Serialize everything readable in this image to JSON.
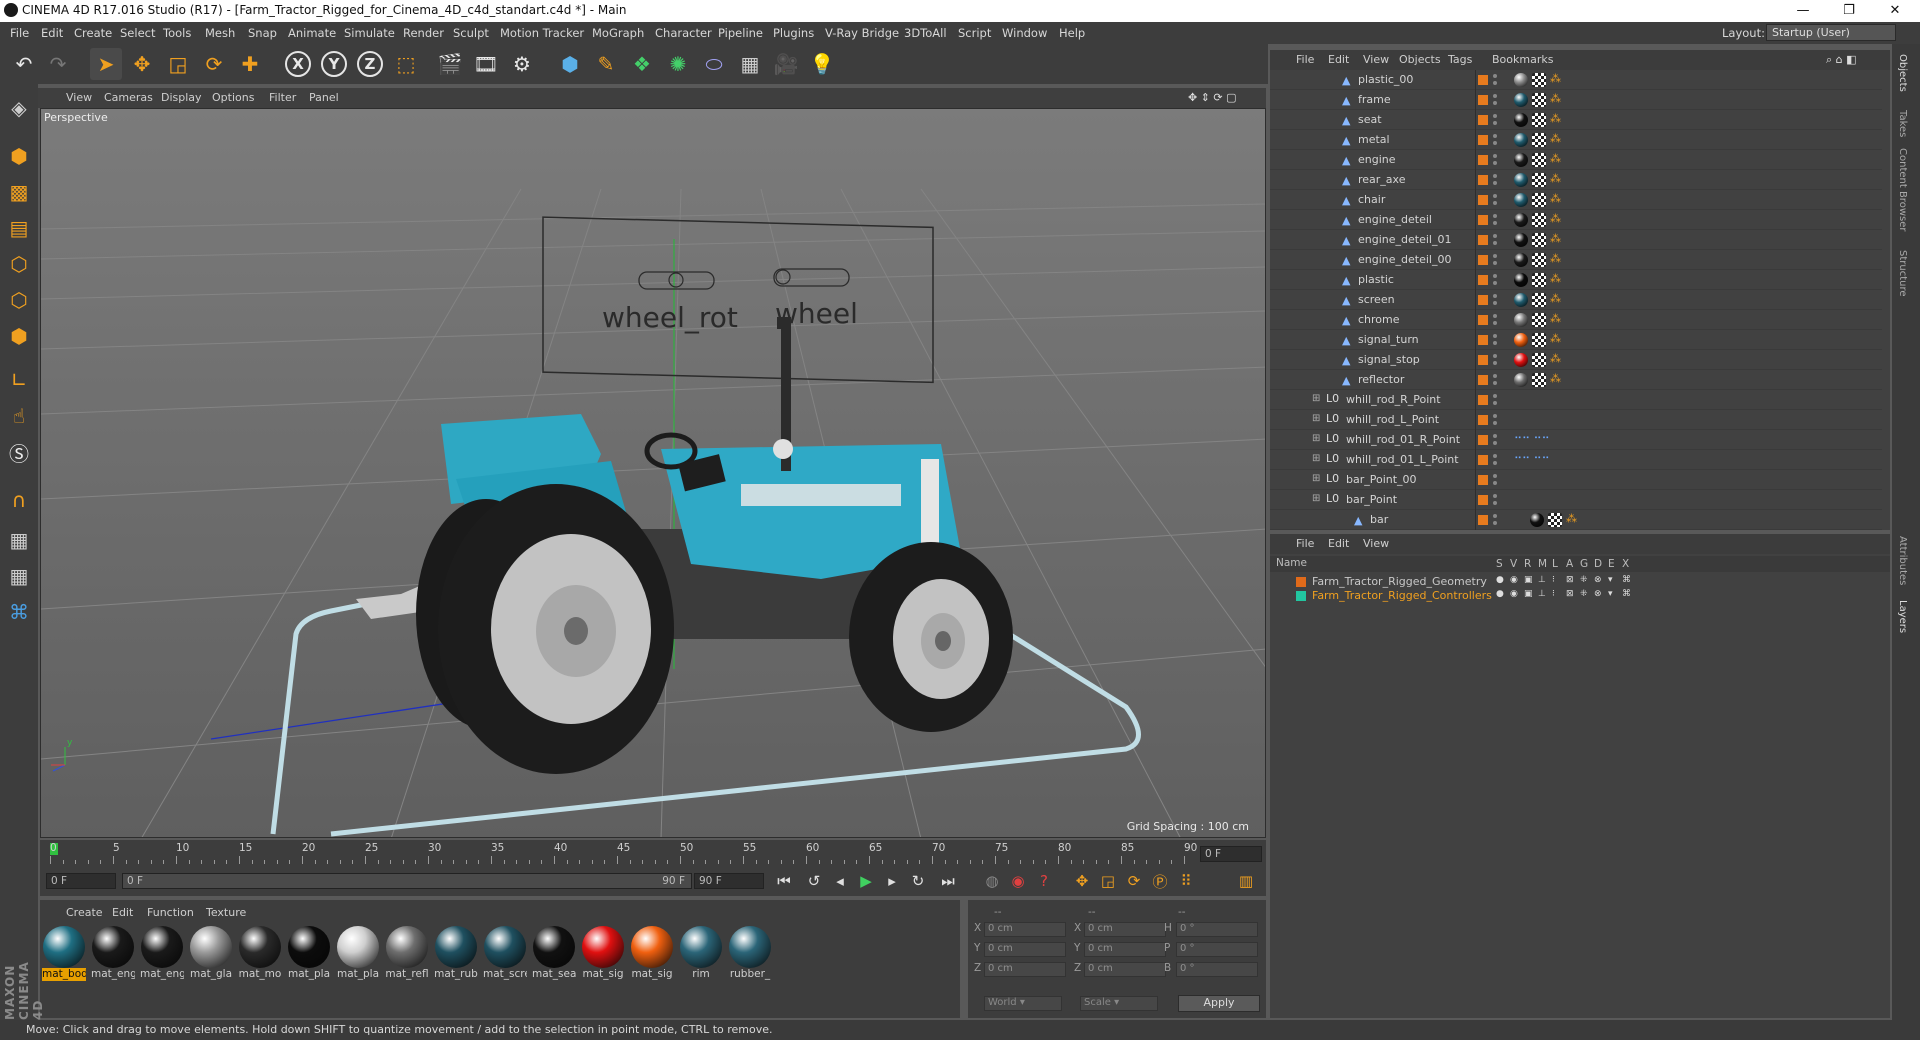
{
  "window": {
    "title": "CINEMA 4D R17.016 Studio (R17) - [Farm_Tractor_Rigged_for_Cinema_4D_c4d_standart.c4d *] - Main",
    "minimize": "—",
    "maximize": "❐",
    "close": "✕"
  },
  "menubar": {
    "items": [
      "File",
      "Edit",
      "Create",
      "Select",
      "Tools",
      "Mesh",
      "Snap",
      "Animate",
      "Simulate",
      "Render",
      "Sculpt",
      "Motion Tracker",
      "MoGraph",
      "Character",
      "Pipeline",
      "Plugins",
      "V-Ray Bridge",
      "3DToAll",
      "Script",
      "Window",
      "Help"
    ],
    "layout_label": "Layout:",
    "layout_value": "Startup (User)"
  },
  "toolbar": {
    "axis_x": "X",
    "axis_y": "Y",
    "axis_z": "Z"
  },
  "viewport": {
    "menu": [
      "View",
      "Cameras",
      "Display",
      "Options",
      "Filter",
      "Panel"
    ],
    "label": "Perspective",
    "grid_spacing": "Grid Spacing : 100 cm",
    "overlay_label_1": "wheel_rot",
    "overlay_label_2": "wheel",
    "axis_y_label": "y"
  },
  "timeline": {
    "ticks": [
      "0",
      "5",
      "10",
      "15",
      "20",
      "25",
      "30",
      "35",
      "40",
      "45",
      "50",
      "55",
      "60",
      "65",
      "70",
      "75",
      "80",
      "85",
      "90"
    ],
    "current_frame_field": "0 F",
    "start_field": "0 F",
    "range_start": "0 F",
    "range_end": "90 F",
    "end_field": "90 F"
  },
  "materials": {
    "menu": [
      "Create",
      "Edit",
      "Function",
      "Texture"
    ],
    "items": [
      {
        "name": "mat_bod",
        "color": "#1f6f83",
        "selected": true
      },
      {
        "name": "mat_eng",
        "color": "#1a1a1a",
        "selected": false
      },
      {
        "name": "mat_eng",
        "color": "#1a1a1a",
        "selected": false
      },
      {
        "name": "mat_gla",
        "color": "#9a9a9a",
        "selected": false
      },
      {
        "name": "mat_mo",
        "color": "#2a2a2a",
        "selected": false
      },
      {
        "name": "mat_pla",
        "color": "#0c0c0c",
        "selected": false
      },
      {
        "name": "mat_pla",
        "color": "#cfcfcf",
        "selected": false
      },
      {
        "name": "mat_refl",
        "color": "#6e6e6e",
        "selected": false
      },
      {
        "name": "mat_rub",
        "color": "#1f5060",
        "selected": false
      },
      {
        "name": "mat_scre",
        "color": "#1f5060",
        "selected": false
      },
      {
        "name": "mat_sea",
        "color": "#111111",
        "selected": false
      },
      {
        "name": "mat_sig",
        "color": "#e01010",
        "selected": false
      },
      {
        "name": "mat_sig",
        "color": "#f06010",
        "selected": false
      },
      {
        "name": "rim",
        "color": "#2b6578",
        "selected": false
      },
      {
        "name": "rubber_",
        "color": "#2b6578",
        "selected": false
      }
    ]
  },
  "coords": {
    "headers": [
      "--",
      "--",
      "--"
    ],
    "rows": [
      {
        "l1": "X",
        "v1": "0 cm",
        "l2": "X",
        "v2": "0 cm",
        "l3": "H",
        "v3": "0 °"
      },
      {
        "l1": "Y",
        "v1": "0 cm",
        "l2": "Y",
        "v2": "0 cm",
        "l3": "P",
        "v3": "0 °"
      },
      {
        "l1": "Z",
        "v1": "0 cm",
        "l2": "Z",
        "v2": "0 cm",
        "l3": "B",
        "v3": "0 °"
      }
    ],
    "world": "World",
    "scale": "Scale",
    "apply": "Apply"
  },
  "object_manager": {
    "menu": [
      "File",
      "Edit",
      "View",
      "Objects",
      "Tags",
      "Bookmarks"
    ],
    "rows": [
      {
        "name": "plastic_00",
        "kind": "poly",
        "indent": 1,
        "tag": "#8a8a8a"
      },
      {
        "name": "frame",
        "kind": "poly",
        "indent": 1,
        "tag": "#1f5a6c"
      },
      {
        "name": "seat",
        "kind": "poly",
        "indent": 1,
        "tag": "#111111"
      },
      {
        "name": "metal",
        "kind": "poly",
        "indent": 1,
        "tag": "#1f5a6c"
      },
      {
        "name": "engine",
        "kind": "poly",
        "indent": 1,
        "tag": "#1a1a1a"
      },
      {
        "name": "rear_axe",
        "kind": "poly",
        "indent": 1,
        "tag": "#1f5a6c"
      },
      {
        "name": "chair",
        "kind": "poly",
        "indent": 1,
        "tag": "#1f5a6c"
      },
      {
        "name": "engine_deteil",
        "kind": "poly",
        "indent": 1,
        "tag": "#1a1a1a"
      },
      {
        "name": "engine_deteil_01",
        "kind": "poly",
        "indent": 1,
        "tag": "#111111"
      },
      {
        "name": "engine_deteil_00",
        "kind": "poly",
        "indent": 1,
        "tag": "#1a1a1a"
      },
      {
        "name": "plastic",
        "kind": "poly",
        "indent": 1,
        "tag": "#0a0a0a"
      },
      {
        "name": "screen",
        "kind": "poly",
        "indent": 1,
        "tag": "#1f5a6c"
      },
      {
        "name": "chrome",
        "kind": "poly",
        "indent": 1,
        "tag": "#777777"
      },
      {
        "name": "signal_turn",
        "kind": "poly",
        "indent": 1,
        "tag": "#f06010"
      },
      {
        "name": "signal_stop",
        "kind": "poly",
        "indent": 1,
        "tag": "#e01010"
      },
      {
        "name": "reflector",
        "kind": "poly",
        "indent": 1,
        "tag": "#6a6a6a"
      },
      {
        "name": "whill_rod_R_Point",
        "kind": "null",
        "indent": 0,
        "tag": ""
      },
      {
        "name": "whill_rod_L_Point",
        "kind": "null",
        "indent": 0,
        "tag": ""
      },
      {
        "name": "whill_rod_01_R_Point",
        "kind": "null",
        "indent": 0,
        "tag": "dots"
      },
      {
        "name": "whill_rod_01_L_Point",
        "kind": "null",
        "indent": 0,
        "tag": "dots"
      },
      {
        "name": "bar_Point_00",
        "kind": "null",
        "indent": 0,
        "tag": ""
      },
      {
        "name": "bar_Point",
        "kind": "null",
        "indent": 0,
        "tag": ""
      },
      {
        "name": "bar",
        "kind": "poly",
        "indent": 2,
        "tag": "#111111"
      }
    ]
  },
  "layer_manager": {
    "menu": [
      "File",
      "Edit",
      "View"
    ],
    "header_name": "Name",
    "header_cols": [
      "S",
      "V",
      "R",
      "M",
      "L",
      "A",
      "G",
      "D",
      "E",
      "X"
    ],
    "layers": [
      {
        "name": "Farm_Tractor_Rigged_Geometry",
        "color": "#e06a1a",
        "text_color": "#c8c8c8"
      },
      {
        "name": "Farm_Tractor_Rigged_Controllers",
        "color": "#22c6a0",
        "text_color": "#f0a020"
      }
    ]
  },
  "right_tabs": [
    "Objects",
    "Takes",
    "Content Browser",
    "Structure",
    "Attributes",
    "Layers"
  ],
  "status": "Move: Click and drag to move elements. Hold down SHIFT to quantize movement / add to the selection in point mode, CTRL to remove.",
  "maxon_logo": "MAXON CINEMA 4D"
}
